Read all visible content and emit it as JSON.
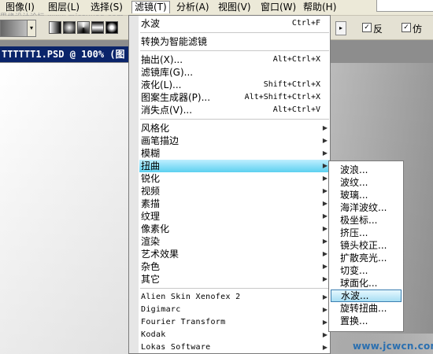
{
  "watermark_top": "思缘设计论坛 www.missyuan.com",
  "menubar": {
    "items": [
      {
        "label": "图像(I)",
        "active": false
      },
      {
        "label": "图层(L)",
        "active": false
      },
      {
        "label": "选择(S)",
        "active": false
      },
      {
        "label": "滤镜(T)",
        "active": true
      },
      {
        "label": "分析(A)",
        "active": false
      },
      {
        "label": "视图(V)",
        "active": false
      },
      {
        "label": "窗口(W)",
        "active": false
      },
      {
        "label": "帮助(H)",
        "active": false
      }
    ]
  },
  "options_bar": {
    "gradient_dropdown_arrow": "▾",
    "play_arrow": "▸",
    "checkbox_checked": "✓",
    "checkbox1_label": "反",
    "checkbox2_label": "仿"
  },
  "document": {
    "title": "TTTTTT1.PSD @ 100% (图"
  },
  "filter_menu": {
    "items": [
      {
        "label": "水波",
        "shortcut": "Ctrl+F"
      },
      {
        "sep": true
      },
      {
        "label": "转换为智能滤镜"
      },
      {
        "sep": true
      },
      {
        "label": "抽出(X)...",
        "shortcut": "Alt+Ctrl+X"
      },
      {
        "label": "滤镜库(G)..."
      },
      {
        "label": "液化(L)...",
        "shortcut": "Shift+Ctrl+X"
      },
      {
        "label": "图案生成器(P)...",
        "shortcut": "Alt+Shift+Ctrl+X"
      },
      {
        "label": "消失点(V)...",
        "shortcut": "Alt+Ctrl+V"
      },
      {
        "sep": true
      },
      {
        "label": "风格化",
        "submenu": true
      },
      {
        "label": "画笔描边",
        "submenu": true
      },
      {
        "label": "模糊",
        "submenu": true
      },
      {
        "label": "扭曲",
        "submenu": true,
        "highlighted": true
      },
      {
        "label": "锐化",
        "submenu": true
      },
      {
        "label": "视频",
        "submenu": true
      },
      {
        "label": "素描",
        "submenu": true
      },
      {
        "label": "纹理",
        "submenu": true
      },
      {
        "label": "像素化",
        "submenu": true
      },
      {
        "label": "渲染",
        "submenu": true
      },
      {
        "label": "艺术效果",
        "submenu": true
      },
      {
        "label": "杂色",
        "submenu": true
      },
      {
        "label": "其它",
        "submenu": true
      },
      {
        "sep": true
      },
      {
        "label": "Alien Skin Xenofex 2",
        "submenu": true,
        "mono": true
      },
      {
        "label": "Digimarc",
        "submenu": true,
        "mono": true
      },
      {
        "label": "Fourier Transform",
        "submenu": true,
        "mono": true
      },
      {
        "label": "Kodak",
        "submenu": true,
        "mono": true
      },
      {
        "label": "Lokas Software",
        "submenu": true,
        "mono": true
      }
    ],
    "submenu_arrow": "▶"
  },
  "distort_submenu": {
    "items": [
      {
        "label": "波浪..."
      },
      {
        "label": "波纹..."
      },
      {
        "label": "玻璃..."
      },
      {
        "label": "海洋波纹..."
      },
      {
        "label": "极坐标..."
      },
      {
        "label": "挤压..."
      },
      {
        "label": "镜头校正..."
      },
      {
        "label": "扩散亮光..."
      },
      {
        "label": "切变..."
      },
      {
        "label": "球面化..."
      },
      {
        "label": "水波...",
        "highlighted": true
      },
      {
        "label": "旋转扭曲..."
      },
      {
        "label": "置换..."
      }
    ]
  },
  "watermark_bottom": "www.jcwcn.com"
}
